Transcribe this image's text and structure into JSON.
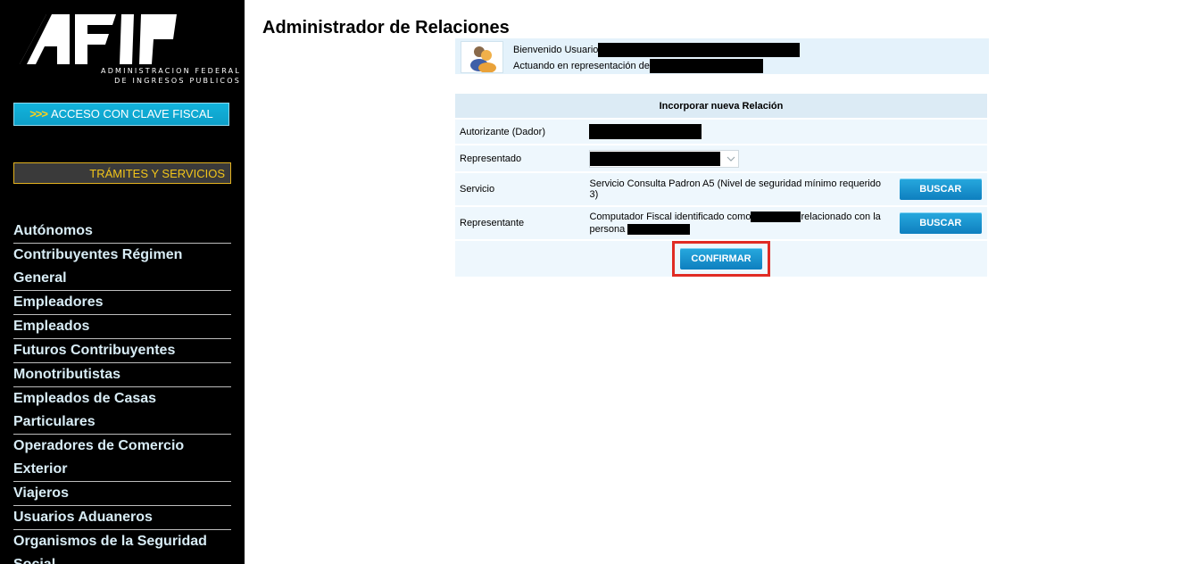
{
  "sidebar": {
    "logo_text": "AFIP",
    "logo_sub_line1": "ADMINISTRACION FEDERAL",
    "logo_sub_line2": "DE INGRESOS PUBLICOS",
    "login_chevrons": ">>>",
    "login_label": "ACCESO CON CLAVE FISCAL",
    "section_label": "TRÁMITES Y SERVICIOS",
    "nav_items": [
      "Autónomos",
      "Contribuyentes Régimen General",
      "Empleadores",
      "Empleados",
      "Futuros Contribuyentes",
      "Monotributistas",
      "Empleados de Casas Particulares",
      "Operadores de Comercio Exterior",
      "Viajeros",
      "Usuarios Aduaneros",
      "Organismos de la Seguridad Social"
    ]
  },
  "main": {
    "title": "Administrador de Relaciones",
    "welcome": {
      "line1": "Bienvenido Usuario",
      "line2": "Actuando en representación de"
    },
    "form": {
      "header": "Incorporar nueva Relación",
      "autorizante_label": "Autorizante (Dador)",
      "representado_label": "Representado",
      "servicio_label": "Servicio",
      "servicio_value": "Servicio Consulta Padron A5 (Nivel de seguridad mínimo requerido 3)",
      "representante_label": "Representante",
      "representante_text_a": "Computador Fiscal identificado como",
      "representante_text_b": "relacionado con la",
      "representante_text_c": "persona",
      "buscar_label": "BUSCAR",
      "confirm_label": "CONFIRMAR"
    }
  },
  "colors": {
    "accent_blue": "#0e8fcf",
    "highlight_red": "#e02b24",
    "sidebar_bg": "#000000",
    "panel_bg": "#eef7fd"
  }
}
